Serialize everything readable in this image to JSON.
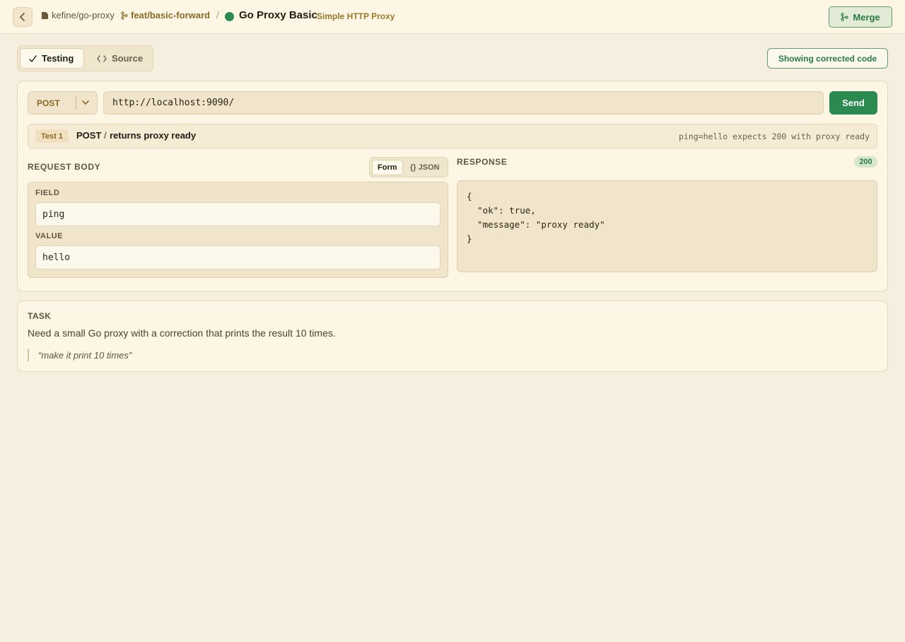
{
  "header": {
    "repo": "kefine/go-proxy",
    "branch": "feat/basic-forward",
    "separator": "/",
    "title": "Go Proxy Basic",
    "subtitle": "Simple HTTP Proxy",
    "merge_label": "Merge",
    "status_color": "#2a8a4f"
  },
  "tabs": [
    {
      "label": "Testing",
      "icon": "check-icon",
      "active": true
    },
    {
      "label": "Source",
      "icon": "code-icon",
      "active": false
    }
  ],
  "corrected_label": "Showing corrected code",
  "request": {
    "method": "POST",
    "url": "http://localhost:9090/",
    "send_label": "Send"
  },
  "test": {
    "badge": "Test 1",
    "method": "POST",
    "path": "/",
    "name": "returns proxy ready",
    "expectation": "ping=hello expects 200 with proxy ready"
  },
  "request_body": {
    "label": "REQUEST BODY",
    "modes": [
      "Form",
      "{} JSON"
    ],
    "active_mode": "Form",
    "field_label": "FIELD",
    "field_value": "ping",
    "value_label": "VALUE",
    "value_value": "hello"
  },
  "response": {
    "label": "RESPONSE",
    "status": "200",
    "body": "{\n  \"ok\": true,\n  \"message\": \"proxy ready\"\n}"
  },
  "task": {
    "label": "TASK",
    "text": "Need a small Go proxy with a correction that prints the result 10 times.",
    "quote": "“make it print 10 times”"
  },
  "colors": {
    "accent": "#2a8a4f",
    "brand_brown": "#8a6a26",
    "background": "#f6efdf"
  }
}
